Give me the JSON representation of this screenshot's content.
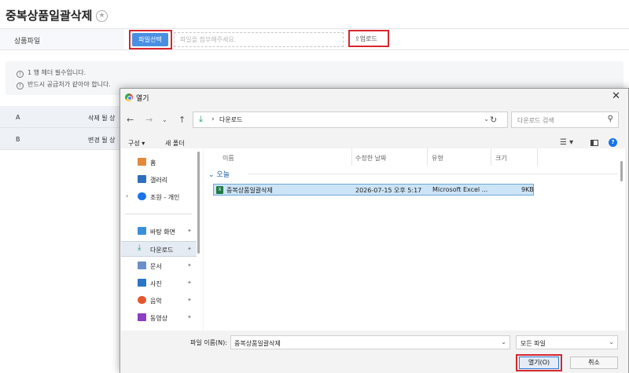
{
  "page": {
    "title": "중복상품일괄삭제",
    "upload": {
      "label": "상품파일",
      "file_button": "파일선택",
      "placeholder": "파일을 첨부해주세요.",
      "upload_button": "업로드"
    },
    "notices": [
      "1 행 헤더 필수입니다.",
      "반드시 공급처가 같아야 합니다."
    ],
    "table_rows": [
      {
        "col1": "A",
        "col2": "삭제 될 상"
      },
      {
        "col1": "B",
        "col2": "변경 될 상"
      }
    ]
  },
  "dialog": {
    "title": "열기",
    "address": {
      "separator": "›",
      "location": "다운로드"
    },
    "search_placeholder": "다운로드 검색",
    "toolbar": {
      "organize": "구성 ▾",
      "new_folder": "새 폴더"
    },
    "nav_items": [
      {
        "label": "홈",
        "icon": "home-icon"
      },
      {
        "label": "갤러리",
        "icon": "gallery-icon"
      },
      {
        "label": "조원 - 개인",
        "icon": "cloud-icon"
      },
      {
        "label": "바탕 화면",
        "icon": "desktop-icon"
      },
      {
        "label": "다운로드",
        "icon": "download-icon"
      },
      {
        "label": "문서",
        "icon": "document-icon"
      },
      {
        "label": "사진",
        "icon": "pictures-icon"
      },
      {
        "label": "음악",
        "icon": "music-icon"
      },
      {
        "label": "동영상",
        "icon": "video-icon"
      }
    ],
    "columns": {
      "name": "이름",
      "modified": "수정한 날짜",
      "type": "유형",
      "size": "크기"
    },
    "group": "오늘",
    "file": {
      "name": "중복상품일괄삭제",
      "modified": "2026-07-15 오후 5:17",
      "type": "Microsoft Excel ...",
      "size": "9KB"
    },
    "filename_label": "파일 이름(N):",
    "filename_value": "중복상품일괄삭제",
    "file_type": "모든 파일",
    "open_button": "열기(O)",
    "cancel_button": "취소"
  },
  "colors": {
    "accent_blue": "#4a90e2",
    "highlight_red": "#d9262e",
    "selection_blue": "#cce4f7",
    "excel_green": "#1d7a43"
  }
}
